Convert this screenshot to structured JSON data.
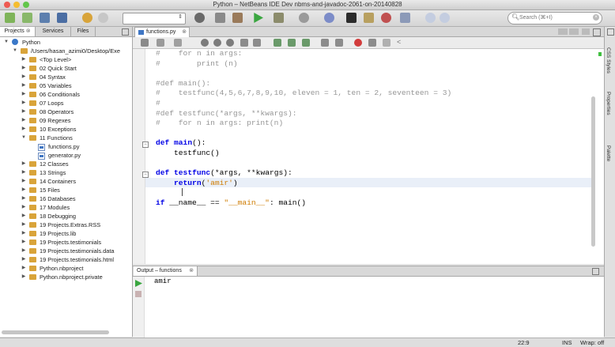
{
  "window": {
    "title": "Python – NetBeans IDE Dev nbms-and-javadoc-2061-on-20140828"
  },
  "toolbar": {
    "search_placeholder": "Search (⌘+I)",
    "config_value": ""
  },
  "left_panel": {
    "tabs": [
      "Projects",
      "Services",
      "Files"
    ],
    "tree": [
      {
        "label": "Python",
        "depth": 0,
        "toggle": "▼",
        "icon": "project"
      },
      {
        "label": "/Users/hasan_azimi0/Desktop/Exe",
        "depth": 1,
        "toggle": "▼",
        "icon": "folder"
      },
      {
        "label": "<Top Level>",
        "depth": 2,
        "toggle": "▶",
        "icon": "folder"
      },
      {
        "label": "02 Quick Start",
        "depth": 2,
        "toggle": "▶",
        "icon": "folder"
      },
      {
        "label": "04 Syntax",
        "depth": 2,
        "toggle": "▶",
        "icon": "folder"
      },
      {
        "label": "05 Variables",
        "depth": 2,
        "toggle": "▶",
        "icon": "folder"
      },
      {
        "label": "06 Conditionals",
        "depth": 2,
        "toggle": "▶",
        "icon": "folder"
      },
      {
        "label": "07 Loops",
        "depth": 2,
        "toggle": "▶",
        "icon": "folder"
      },
      {
        "label": "08 Operators",
        "depth": 2,
        "toggle": "▶",
        "icon": "folder"
      },
      {
        "label": "09 Regexes",
        "depth": 2,
        "toggle": "▶",
        "icon": "folder"
      },
      {
        "label": "10 Exceptions",
        "depth": 2,
        "toggle": "▶",
        "icon": "folder"
      },
      {
        "label": "11 Functions",
        "depth": 2,
        "toggle": "▼",
        "icon": "folder"
      },
      {
        "label": "functions.py",
        "depth": 3,
        "toggle": "",
        "icon": "py"
      },
      {
        "label": "generator.py",
        "depth": 3,
        "toggle": "",
        "icon": "py"
      },
      {
        "label": "12 Classes",
        "depth": 2,
        "toggle": "▶",
        "icon": "folder"
      },
      {
        "label": "13 Strings",
        "depth": 2,
        "toggle": "▶",
        "icon": "folder"
      },
      {
        "label": "14 Containers",
        "depth": 2,
        "toggle": "▶",
        "icon": "folder"
      },
      {
        "label": "15 Files",
        "depth": 2,
        "toggle": "▶",
        "icon": "folder"
      },
      {
        "label": "16 Databases",
        "depth": 2,
        "toggle": "▶",
        "icon": "folder"
      },
      {
        "label": "17 Modules",
        "depth": 2,
        "toggle": "▶",
        "icon": "folder"
      },
      {
        "label": "18 Debugging",
        "depth": 2,
        "toggle": "▶",
        "icon": "folder"
      },
      {
        "label": "19 Projects.Extras.RSS",
        "depth": 2,
        "toggle": "▶",
        "icon": "folder"
      },
      {
        "label": "19 Projects.lib",
        "depth": 2,
        "toggle": "▶",
        "icon": "folder"
      },
      {
        "label": "19 Projects.testimonials",
        "depth": 2,
        "toggle": "▶",
        "icon": "folder"
      },
      {
        "label": "19 Projects.testimonials.data",
        "depth": 2,
        "toggle": "▶",
        "icon": "folder"
      },
      {
        "label": "19 Projects.testimonials.html",
        "depth": 2,
        "toggle": "▶",
        "icon": "folder"
      },
      {
        "label": "Python.nbproject",
        "depth": 2,
        "toggle": "▶",
        "icon": "folder"
      },
      {
        "label": "Python.nbproject.private",
        "depth": 2,
        "toggle": "▶",
        "icon": "folder"
      }
    ]
  },
  "editor": {
    "tab_label": "functions.py",
    "lines": [
      {
        "text": "#    for n in args:",
        "kind": "comment"
      },
      {
        "text": "#        print (n)",
        "kind": "comment"
      },
      {
        "text": "",
        "kind": "plain"
      },
      {
        "text": "#def main():",
        "kind": "comment"
      },
      {
        "text": "#    testfunc(4,5,6,7,8,9,10, eleven = 1, ten = 2, seventeen = 3)",
        "kind": "comment"
      },
      {
        "text": "#",
        "kind": "comment"
      },
      {
        "text": "#def testfunc(*args, **kwargs):",
        "kind": "comment"
      },
      {
        "text": "#    for n in args: print(n)",
        "kind": "comment"
      },
      {
        "text": "",
        "kind": "plain"
      },
      {
        "text": "def main():",
        "kind": "def",
        "kw": "def",
        "name": "main",
        "rest": "():"
      },
      {
        "text": "    testfunc()",
        "kind": "plain"
      },
      {
        "text": "",
        "kind": "plain"
      },
      {
        "text": "def testfunc(*args, **kwargs):",
        "kind": "def",
        "kw": "def",
        "name": "testfunc",
        "rest": "(*args, **kwargs):"
      },
      {
        "text": "    return('amir')",
        "kind": "return",
        "pre": "    ",
        "kw": "return",
        "mid": "(",
        "str": "'amir'",
        "post": ")"
      },
      {
        "text": "",
        "kind": "plain"
      },
      {
        "text": "if __name__ == \"__main__\": main()",
        "kind": "if",
        "kw": "if",
        "mid": " __name__ == ",
        "str": "\"__main__\"",
        "post": ": main()"
      }
    ]
  },
  "output": {
    "tab_label": "Output – functions",
    "text": "amir"
  },
  "right_strip": [
    "CSS Styles",
    "Properties",
    "Palette"
  ],
  "statusbar": {
    "position": "22:9",
    "mode": "INS",
    "wrap": "Wrap: off"
  }
}
